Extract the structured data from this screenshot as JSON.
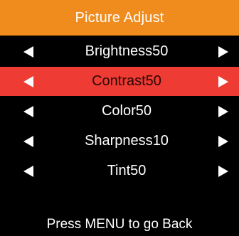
{
  "menu": {
    "title": "Picture Adjust",
    "items": [
      {
        "label": "Brightness",
        "value": "50",
        "selected": false
      },
      {
        "label": "Contrast",
        "value": "50",
        "selected": true
      },
      {
        "label": "Color",
        "value": "50",
        "selected": false
      },
      {
        "label": "Sharpness",
        "value": "10",
        "selected": false
      },
      {
        "label": "Tint",
        "value": "50",
        "selected": false
      }
    ],
    "footer": "Press MENU to go Back"
  },
  "colors": {
    "title_bar": "#f08c1e",
    "selected_row": "#ee3b34",
    "background": "#000000",
    "text": "#ffffff",
    "selected_text": "#2a0505"
  },
  "icons": {
    "left_arrow": "triangle-left-icon",
    "right_arrow": "triangle-right-icon"
  }
}
